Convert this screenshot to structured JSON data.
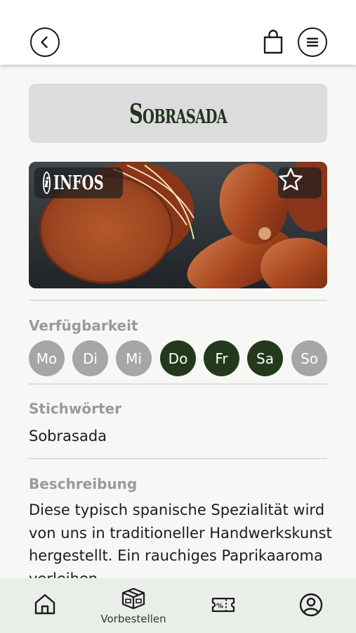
{
  "header": {
    "back_icon": "chevron-left-icon",
    "cart_icon": "shopping-bag-icon",
    "menu_icon": "hamburger-menu-icon"
  },
  "product": {
    "title": "Sobrasada",
    "infos_label": "INFOS",
    "favorite_icon": "star-outline-icon"
  },
  "availability": {
    "label": "Verfügbarkeit",
    "days": [
      {
        "label": "Mo",
        "active": false
      },
      {
        "label": "Di",
        "active": false
      },
      {
        "label": "Mi",
        "active": false
      },
      {
        "label": "Do",
        "active": true
      },
      {
        "label": "Fr",
        "active": true
      },
      {
        "label": "Sa",
        "active": true
      },
      {
        "label": "So",
        "active": false
      }
    ]
  },
  "keywords": {
    "label": "Stichwörter",
    "value": "Sobrasada"
  },
  "description": {
    "label": "Beschreibung",
    "text": "Diese typisch spanische Spezialität wird von uns in traditioneller Handwerkskunst hergestellt. Ein rauchiges Paprikaaroma verleihen"
  },
  "bottom_nav": {
    "items": [
      {
        "label": "",
        "icon": "home-icon"
      },
      {
        "label": "Vorbestellen",
        "icon": "box-icon"
      },
      {
        "label": "",
        "icon": "coupon-icon"
      },
      {
        "label": "",
        "icon": "user-icon"
      }
    ]
  },
  "colors": {
    "active_day": "#22391b",
    "inactive_day": "#a6a6a6",
    "title_box": "#dcdcdc",
    "bottom_nav_bg": "#e9efe8"
  }
}
